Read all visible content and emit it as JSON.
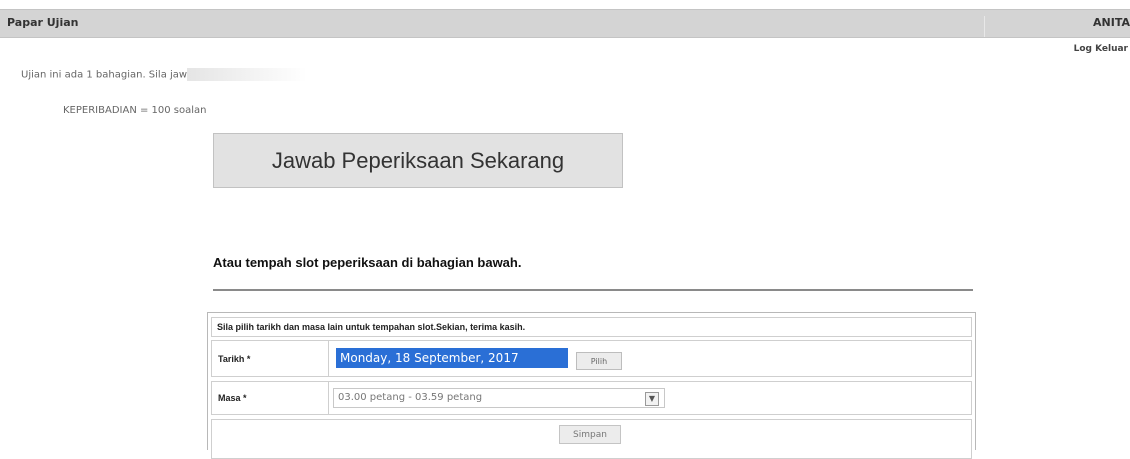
{
  "header": {
    "title": "Papar Ujian",
    "user_name": "ANITA"
  },
  "logout_label": "Log Keluar",
  "intro": {
    "text": "Ujian ini ada 1 bahagian. Sila jaw"
  },
  "sections": [
    {
      "text": "KEPERIBADIAN = 100 soalan"
    }
  ],
  "answer_button_label": "Jawab Peperiksaan Sekarang",
  "booking": {
    "heading": "Atau tempah slot peperiksaan di bahagian bawah.",
    "note": "Sila pilih tarikh dan masa lain untuk tempahan slot.Sekian, terima kasih.",
    "date_label": "Tarikh *",
    "date_value": "Monday, 18 September, 2017",
    "pick_label": "Pilih",
    "time_label": "Masa *",
    "time_value": "03.00 petang - 03.59 petang",
    "save_label": "Simpan"
  }
}
